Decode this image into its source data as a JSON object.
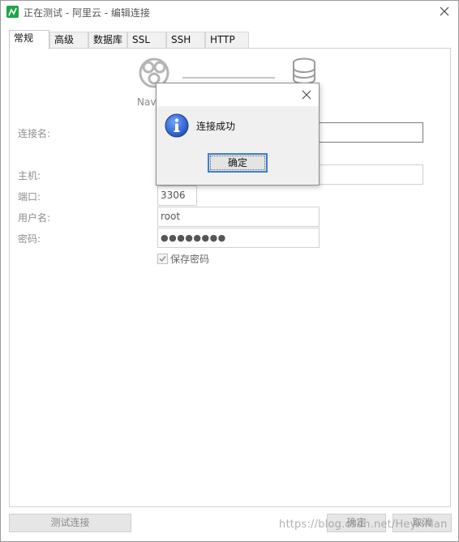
{
  "window": {
    "title": "正在测试 - 阿里云 - 编辑连接"
  },
  "tabs": [
    {
      "label": "常规",
      "active": true
    },
    {
      "label": "高级",
      "active": false
    },
    {
      "label": "数据库",
      "active": false
    },
    {
      "label": "SSL",
      "active": false
    },
    {
      "label": "SSH",
      "active": false
    },
    {
      "label": "HTTP",
      "active": false
    }
  ],
  "diagram": {
    "left_label": "Nav"
  },
  "form": {
    "connection_name_label": "连接名:",
    "connection_name_value": "",
    "host_label": "主机:",
    "host_value": "",
    "port_label": "端口:",
    "port_value": "3306",
    "username_label": "用户名:",
    "username_value": "root",
    "password_label": "密码:",
    "password_value": "●●●●●●●●",
    "save_password_label": "保存密码",
    "save_password_checked": true
  },
  "footer": {
    "test_button": "测试连接",
    "ok_button": "确定",
    "cancel_button": "取消"
  },
  "watermark": "https://blog.csdn.net/HeyHMan",
  "dialog": {
    "message": "连接成功",
    "ok_button": "确定",
    "icon": "info-icon"
  },
  "colors": {
    "accent": "#3c7fd1",
    "app_icon": "#1fa448",
    "info_icon": "#1f4fb8"
  }
}
